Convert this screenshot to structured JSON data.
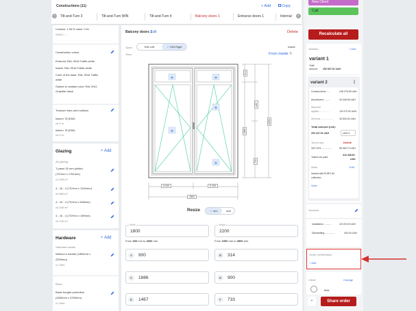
{
  "header": {
    "title": "Constructions (11)",
    "add_label": "+ Add",
    "copy_label": "Copy",
    "tabs": [
      "Tilt-and-Turn 3",
      "Tilt-and-Turn WIN",
      "Tilt-and-Turn 4",
      "Balcony doors 1",
      "Entrance doors 1",
      "Internal"
    ]
  },
  "right_top": {
    "new_client_label": "New Client",
    "call_label": "Call",
    "recalculate_label": "Recalculate all"
  },
  "left": {
    "u_factor": "U-factor: 1.95  R-value: 0.51",
    "shgc": "SHGC: --",
    "construction_colors": {
      "title": "Construction colors",
      "external": "External: RAL 9016 Traffic white",
      "inside": "Inside: RAL 9016 Traffic white",
      "base_line1": "Color of the base: RAL 9016 Traffic",
      "base_line2": "white",
      "gasket_line1": "Gasket or sealant color: RAL 9011",
      "gasket_line2": "Graphite black"
    },
    "transom": {
      "title": "Transom bars and mullions",
      "item1": "Імпост 78 (E60)",
      "item1_qty": "x0.9 m",
      "item2": "Імпост 78 (E60)",
      "item2_qty": "x0.9 m"
    },
    "glazing": {
      "title": "Glazing",
      "add_label": "+ Add",
      "subtitle": "All glazing",
      "items": [
        {
          "l1": "T-panel 32 mm (white)",
          "l2": "(737mm x 1761mm)",
          "qty": "x1.298 m²"
        },
        {
          "l1": "4 - 16 - 4 (737mm x 1342mm)",
          "l2": "",
          "qty": "x0.989 m²"
        },
        {
          "l1": "4 - 16 - 4 (737mm x 608mm)",
          "l2": "",
          "qty": "x0.448 m²"
        },
        {
          "l1": "4 - 16 - 4 (737mm x 189mm)",
          "l2": "",
          "qty": "x0.139 m²"
        }
      ]
    },
    "hardware": {
      "title": "Hardware",
      "add_label": "+ Add",
      "subtitle": "Standard handle",
      "item1_l1": "Without a handle (1800mm x",
      "item1_l2": "2200mm)",
      "item1_qty": "x1 Sets",
      "subtitle2": "Basic",
      "item2_l1": "Basic burglar protection",
      "item2_l2": "(1800mm x 2200mm)",
      "item2_qty": "x1 Sets"
    }
  },
  "center": {
    "construction_name": "Balcony doors 1",
    "edit_label": "Edit",
    "delete_label": "Delete",
    "open_label": "Open:",
    "din_left": "DIN Left",
    "din_right": "DIN Right",
    "inside_label": "Inside",
    "view_label": "View:",
    "from_inside": "From inside",
    "dims": {
      "a": "900",
      "b": "900",
      "total_w": "1800",
      "total_h": "2200",
      "h1": "314",
      "h2": "1467",
      "h3": "1886",
      "h4": "733"
    },
    "resize_label": "Resize",
    "mm_label": "mm",
    "inch_label": "inch",
    "width_label": "Width",
    "width_value": "1800",
    "width_hint_pre": "From ",
    "width_min": "400",
    "width_mid": " mm to ",
    "width_max": "4000",
    "width_hint_post": " mm",
    "height_label": "Height",
    "height_value": "2200",
    "height_min": "1500",
    "height_max": "3500",
    "params": [
      {
        "letter": "A",
        "value": "900"
      },
      {
        "letter": "B",
        "value": "314"
      },
      {
        "letter": "C",
        "value": "1886"
      },
      {
        "letter": "D",
        "value": "900"
      },
      {
        "letter": "E",
        "value": "1467"
      },
      {
        "letter": "F",
        "value": "733"
      }
    ]
  },
  "right": {
    "variants_label": "Variants",
    "add_label": "+ Add",
    "v1_name": "variant 1",
    "v1_total_label": "Total",
    "v1_amount_label": "amount:",
    "v1_amount": "252 837.91 UAH",
    "v2_name": "variant 2",
    "rows": [
      {
        "label": "Constructions .....",
        "value": "198 278.95 UAH"
      },
      {
        "label": "Assortment .........",
        "value": "34 048.96 UAH"
      },
      {
        "label": "Discount",
        "value": ""
      },
      {
        "label": "applied ...............",
        "value": "-53 070.00 UAH"
      },
      {
        "label": "Services ..................",
        "value": "18 500.00 UAH"
      }
    ],
    "total_net_label": "Total amount (net):",
    "total_net": "252 437.91 UAH",
    "currency": "UAH",
    "tax_label": "Tax (on top)",
    "tax_delete": "Delete",
    "vat_label": "VAT 23% ...............",
    "vat_value": "58 060.72 UAH",
    "to_pay_label": "Total to be paid:",
    "to_pay_value1": "310 498.63",
    "to_pay_value2": "UAH",
    "notes_label": "Notes",
    "notes_edit": "Edit",
    "notes_text_l1": "Variant with EURO 60",
    "notes_text_l2": "collection",
    "view_label": "View",
    "services_label": "Services",
    "installation_label": "Installation ...........",
    "installation_value": "18 100.00 UAH",
    "dismantling_label": "Dismantling ..............",
    "dismantling_value": "400.00 UAH",
    "order_conf_label": "Order confirmation",
    "order_conf_add": "+ Add",
    "client_label": "Client",
    "client_change": "Change",
    "client_name": "Max",
    "share_label": "Share order"
  },
  "colors": {
    "accent": "#2d6cdf",
    "brand_red": "#b71c1c",
    "annotation": "#d32f2f",
    "glass_line": "#5fd3a8",
    "green": "#5cc35a"
  }
}
